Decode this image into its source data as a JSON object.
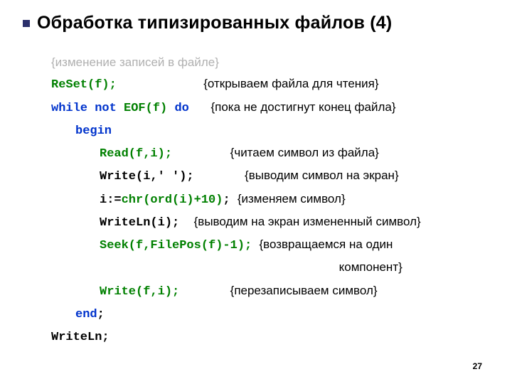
{
  "title": "Обработка типизированных файлов (4)",
  "pageNumber": "27",
  "lines": {
    "l1_comment": "{изменение записей в файле}",
    "l2_code": "ReSet(f);",
    "l2_pad": "            ",
    "l2_comment": "{открываем файла для чтения}",
    "l3_kw1": "while",
    "l3_sp1": " ",
    "l3_kw2": "not",
    "l3_sp2": " ",
    "l3_fn": "EOF(f)",
    "l3_sp3": " ",
    "l3_kw3": "do",
    "l3_pad": "   ",
    "l3_comment": "{пока не достигнут конец файла}",
    "l4_code": "begin",
    "l5_code": "Read(f,i);",
    "l5_pad": "        ",
    "l5_comment": "{читаем символ из файла}",
    "l6_code": "Write(i,' ');",
    "l6_pad": "       ",
    "l6_comment": "{выводим символ на экран}",
    "l7_a": "i:=",
    "l7_b": "chr(ord(i)+10)",
    "l7_c": ";",
    "l7_pad": " ",
    "l7_comment": "{изменяем символ}",
    "l8_code": "WriteLn(i);",
    "l8_pad": "  ",
    "l8_comment": "{выводим на экран измененный символ}",
    "l9_code": "Seek(f,FilePos(f)-1);",
    "l9_pad": " ",
    "l9_comment": "{возвращаемся на один",
    "l10_pad": "                                 ",
    "l10_comment": "компонент}",
    "l11_code": "Write(f,i);",
    "l11_pad": "       ",
    "l11_comment": "{перезаписываем символ}",
    "l12_code": "end",
    "l12_semi": ";",
    "l13_code": "WriteLn;"
  }
}
